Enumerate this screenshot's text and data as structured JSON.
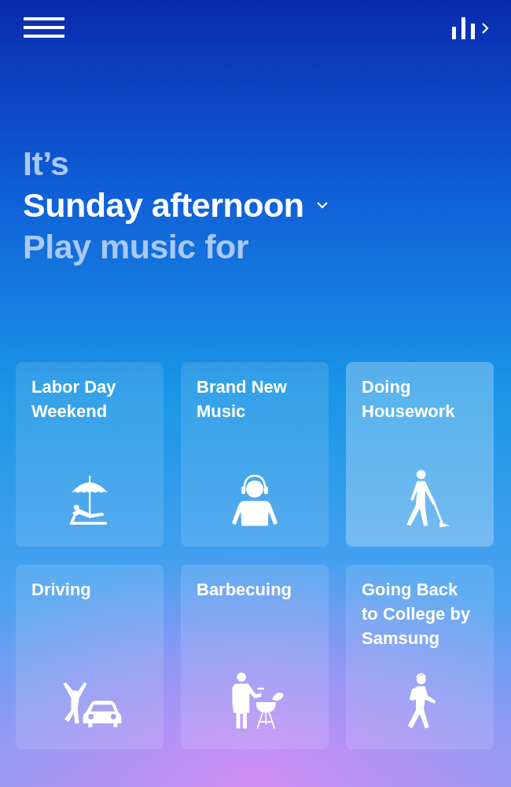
{
  "headline": {
    "intro": "It’s",
    "time_of_day": "Sunday afternoon",
    "prompt": "Play music for"
  },
  "tiles": [
    {
      "title": "Labor Day Weekend",
      "selected": false
    },
    {
      "title": "Brand New Music",
      "selected": false
    },
    {
      "title": "Doing Housework",
      "selected": true
    },
    {
      "title": "Driving",
      "selected": false
    },
    {
      "title": "Barbecuing",
      "selected": false
    },
    {
      "title": "Going Back to College by Samsung",
      "selected": false
    }
  ]
}
